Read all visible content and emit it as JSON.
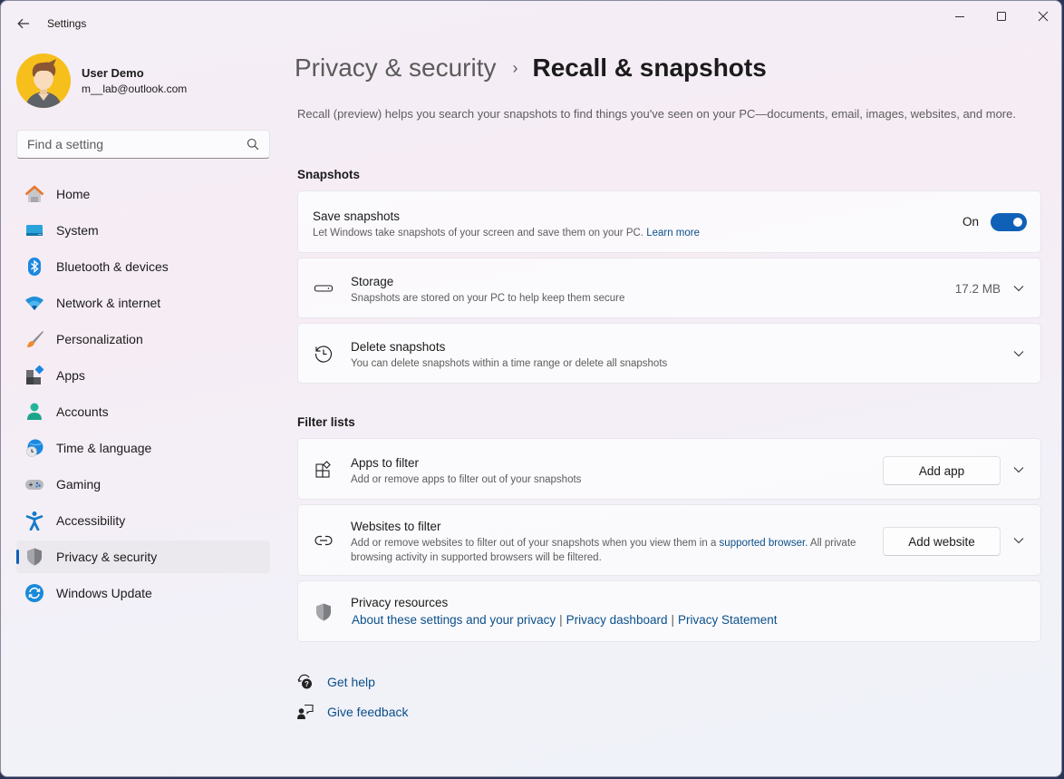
{
  "window": {
    "app_title": "Settings",
    "controls": {
      "minimize": "minimize",
      "maximize": "maximize",
      "close": "close"
    }
  },
  "profile": {
    "name": "User Demo",
    "email": "m__lab@outlook.com"
  },
  "search": {
    "placeholder": "Find a setting",
    "value": ""
  },
  "sidebar": {
    "items": [
      {
        "label": "Home",
        "icon": "home-icon"
      },
      {
        "label": "System",
        "icon": "system-icon"
      },
      {
        "label": "Bluetooth & devices",
        "icon": "bluetooth-icon"
      },
      {
        "label": "Network & internet",
        "icon": "wifi-icon"
      },
      {
        "label": "Personalization",
        "icon": "paintbrush-icon"
      },
      {
        "label": "Apps",
        "icon": "apps-icon"
      },
      {
        "label": "Accounts",
        "icon": "account-icon"
      },
      {
        "label": "Time & language",
        "icon": "globe-clock-icon"
      },
      {
        "label": "Gaming",
        "icon": "gamepad-icon"
      },
      {
        "label": "Accessibility",
        "icon": "accessibility-icon"
      },
      {
        "label": "Privacy & security",
        "icon": "shield-icon",
        "active": true
      },
      {
        "label": "Windows Update",
        "icon": "update-icon"
      }
    ]
  },
  "breadcrumb": {
    "parent": "Privacy & security",
    "separator": "›",
    "current": "Recall & snapshots"
  },
  "description": "Recall (preview) helps you search your snapshots to find things you've seen on your PC—documents, email, images, websites, and more.",
  "snapshots_section": {
    "title": "Snapshots",
    "save": {
      "title": "Save snapshots",
      "subtitle": "Let Windows take snapshots of your screen and save them on your PC.",
      "link": "Learn more",
      "toggle_state": "On",
      "toggle_on": true
    },
    "storage": {
      "title": "Storage",
      "subtitle": "Snapshots are stored on your PC to help keep them secure",
      "value": "17.2 MB"
    },
    "delete": {
      "title": "Delete snapshots",
      "subtitle": "You can delete snapshots within a time range or delete all snapshots"
    }
  },
  "filter_section": {
    "title": "Filter lists",
    "apps": {
      "title": "Apps to filter",
      "subtitle": "Add or remove apps to filter out of your snapshots",
      "button": "Add app"
    },
    "websites": {
      "title": "Websites to filter",
      "subtitle_before": "Add or remove websites to filter out of your snapshots when you view them in a",
      "subtitle_link": "supported browser.",
      "subtitle_after": "All private browsing activity in supported browsers will be filtered.",
      "button": "Add website"
    },
    "privacy_resources": {
      "title": "Privacy resources",
      "links": [
        "About these settings and your privacy",
        "Privacy dashboard",
        "Privacy Statement"
      ],
      "separator": "|"
    }
  },
  "help": {
    "get_help": "Get help",
    "give_feedback": "Give feedback"
  },
  "colors": {
    "accent": "#0f61b8",
    "link": "#0b4f8a",
    "avatar_bg": "#f7bf1b"
  }
}
